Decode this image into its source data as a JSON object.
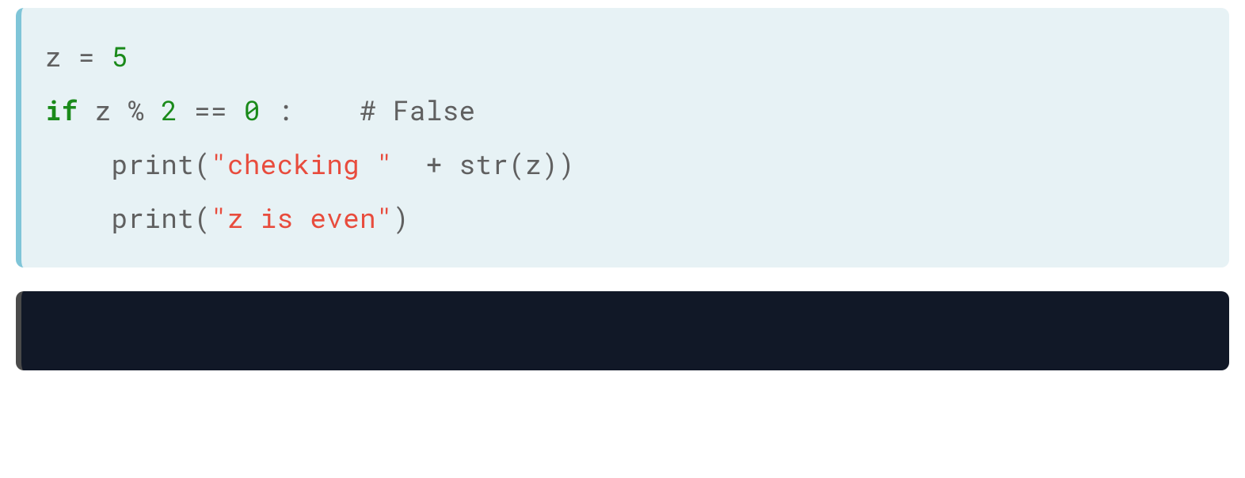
{
  "code": {
    "line1": {
      "var": "z ",
      "assign": "= ",
      "val": "5"
    },
    "line2": {
      "keyword": "if",
      "expr1": " z % ",
      "num1": "2",
      "expr2": " == ",
      "num2": "0",
      "expr3": " :    ",
      "comment": "# False"
    },
    "line3": {
      "indent": "    print(",
      "string": "\"checking \"",
      "rest": "  + str(z))"
    },
    "line4": {
      "indent": "    print(",
      "string": "\"z is even\"",
      "rest": ")"
    }
  },
  "output": ""
}
